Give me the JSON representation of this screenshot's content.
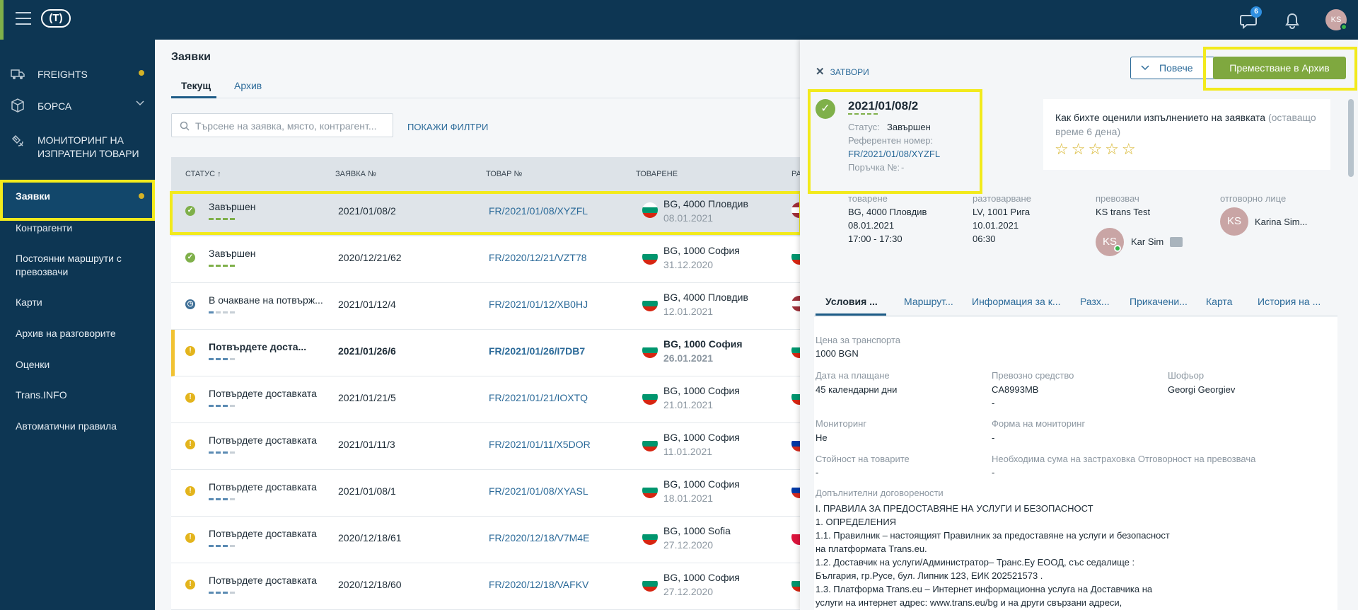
{
  "topbar": {
    "logo_text": "T",
    "notifications_badge": "6",
    "user_initials": "KS"
  },
  "sidebar": {
    "main_items": [
      {
        "label": "FREIGHTS",
        "icon": "truck-icon"
      },
      {
        "label": "БОРСА",
        "icon": "cube-icon"
      },
      {
        "label": "МОНИТОРИНГ НА\nИЗПРАТЕНИ ТОВАРИ",
        "icon": "satellite-icon"
      }
    ],
    "items": [
      "Заявки",
      "Контрагенти",
      "Постоянни маршрути с\nпревозвачи",
      "Карти",
      "Архив на разговорите",
      "Оценки",
      "Trans.INFO",
      "Автоматични правила"
    ]
  },
  "main": {
    "title": "Заявки",
    "tabs": [
      "Текущ",
      "Архив"
    ],
    "search_placeholder": "Търсене на заявка, място, контрагент...",
    "show_filters": "ПОКАЖИ ФИЛТРИ",
    "columns": [
      "СТАТУС ↑",
      "ЗАЯВКА №",
      "ТОВАР №",
      "ТОВАРЕНЕ",
      "РАЗТО"
    ],
    "rows": [
      {
        "status": "Завършен",
        "kind": "done",
        "order": "2021/01/08/2",
        "cargo": "FR/2021/01/08/XYZFL",
        "load_place": "BG, 4000 Пловдив",
        "load_date": "08.01.2021",
        "unload_flag": "lv"
      },
      {
        "status": "Завършен",
        "kind": "done",
        "order": "2020/12/21/62",
        "cargo": "FR/2020/12/21/VZT78",
        "load_place": "BG, 1000 София",
        "load_date": "31.12.2020",
        "unload_flag": "bg"
      },
      {
        "status": "В очакване на потвърж...",
        "kind": "wait",
        "order": "2021/01/12/4",
        "cargo": "FR/2021/01/12/XB0HJ",
        "load_place": "BG, 4000 Пловдив",
        "load_date": "12.01.2021",
        "unload_flag": "lv"
      },
      {
        "status": "Потвърдете доста...",
        "kind": "warn",
        "order": "2021/01/26/6",
        "cargo": "FR/2021/01/26/I7DB7",
        "load_place": "BG, 1000 София",
        "load_date": "26.01.2021",
        "unload_flag": "bg"
      },
      {
        "status": "Потвърдете доставката",
        "kind": "warn",
        "order": "2021/01/21/5",
        "cargo": "FR/2021/01/21/IOXTQ",
        "load_place": "BG, 1000 София",
        "load_date": "21.01.2021",
        "unload_flag": "bg"
      },
      {
        "status": "Потвърдете доставката",
        "kind": "warn",
        "order": "2021/01/11/3",
        "cargo": "FR/2021/01/11/X5DOR",
        "load_place": "BG, 1000 София",
        "load_date": "11.01.2021",
        "unload_flag": "ru"
      },
      {
        "status": "Потвърдете доставката",
        "kind": "warn",
        "order": "2021/01/08/1",
        "cargo": "FR/2021/01/08/XYASL",
        "load_place": "BG, 1000 София",
        "load_date": "18.01.2021",
        "unload_flag": "ru"
      },
      {
        "status": "Потвърдете доставката",
        "kind": "warn",
        "order": "2020/12/18/61",
        "cargo": "FR/2020/12/18/V7M4E",
        "load_place": "BG, 1000 Sofia",
        "load_date": "27.12.2020",
        "unload_flag": "pl"
      },
      {
        "status": "Потвърдете доставката",
        "kind": "warn",
        "order": "2020/12/18/60",
        "cargo": "FR/2020/12/18/VAFKV",
        "load_place": "BG, 1000 София",
        "load_date": "27.12.2020",
        "unload_flag": "bg"
      }
    ]
  },
  "panel": {
    "close": "ЗАТВОРИ",
    "more": "Повече",
    "archive": "Преместване в Архив",
    "order_no": "2021/01/08/2",
    "status_label": "Статус:",
    "status_value": "Завършен",
    "ref_label": "Референтен номер:",
    "ref_value": "FR/2021/01/08/XYZFL",
    "po_label": "Поръчка №:",
    "po_value": "-",
    "rating_question": "Как бихте оценили изпълнението на заявката",
    "rating_remaining": "(оставащо време 6 дена)",
    "stars": "☆☆☆☆☆",
    "loading_label": "товарене",
    "loading_lines": [
      "BG, 4000 Пловдив",
      "08.01.2021",
      "17:00 - 17:30"
    ],
    "unloading_label": "разтоварване",
    "unloading_lines": [
      "LV, 1001 Рига",
      "10.01.2021",
      "06:30"
    ],
    "carrier_label": "превозвач",
    "carrier_name": "KS trans Test",
    "carrier_person": "Kar Sim",
    "carrier_initials": "KS",
    "responsible_label": "отговорно лице",
    "responsible_name": "Karina Sim...",
    "responsible_initials": "KS",
    "tabs": [
      "Условия ...",
      "Маршрут...",
      "Информация за к...",
      "Разх...",
      "Прикачени...",
      "Карта",
      "История на ..."
    ],
    "fields": {
      "price_label": "Цена за транспорта",
      "price_value": "1000 BGN",
      "payment_label": "Дата на плащане",
      "payment_value": "45 календарни дни",
      "vehicle_label": "Превозно средство",
      "vehicle_value": "CA8993MB",
      "vehicle_value2": "-",
      "driver_label": "Шофьор",
      "driver_value": "Georgi Georgiev",
      "monitoring_label": "Мониторинг",
      "monitoring_value": "Не",
      "monitoring_form_label": "Форма на мониторинг",
      "monitoring_form_value": "-",
      "goods_value_label": "Стойност на товарите",
      "goods_value_value": "-",
      "insurance_label": "Необходима сума на застраховка Отговорност на превозвача",
      "insurance_value": "-",
      "additional_label": "Допълнителни договорености"
    },
    "terms_lines": [
      "I. ПРАВИЛА ЗА ПРЕДОСТАВЯНЕ НА УСЛУГИ И БЕЗОПАСНОСТ",
      "1. ОПРЕДЕЛЕНИЯ",
      "1.1. Правилник – настоящият Правилник за предоставяне на услуги и безопасност",
      "на платформата Trans.eu.",
      "1.2. Доставчик на услуги/Администратор– Транс.Еу ЕООД, със седалище :",
      "България, гр.Русе, бул. Липник 123, ЕИК 202521573 .",
      "1.3. Платформа Trans.eu – Интернет информационна услуга на Доставчика на",
      "услуги на интернет адрес: www.trans.eu/bg и на други свързани адреси,"
    ]
  }
}
